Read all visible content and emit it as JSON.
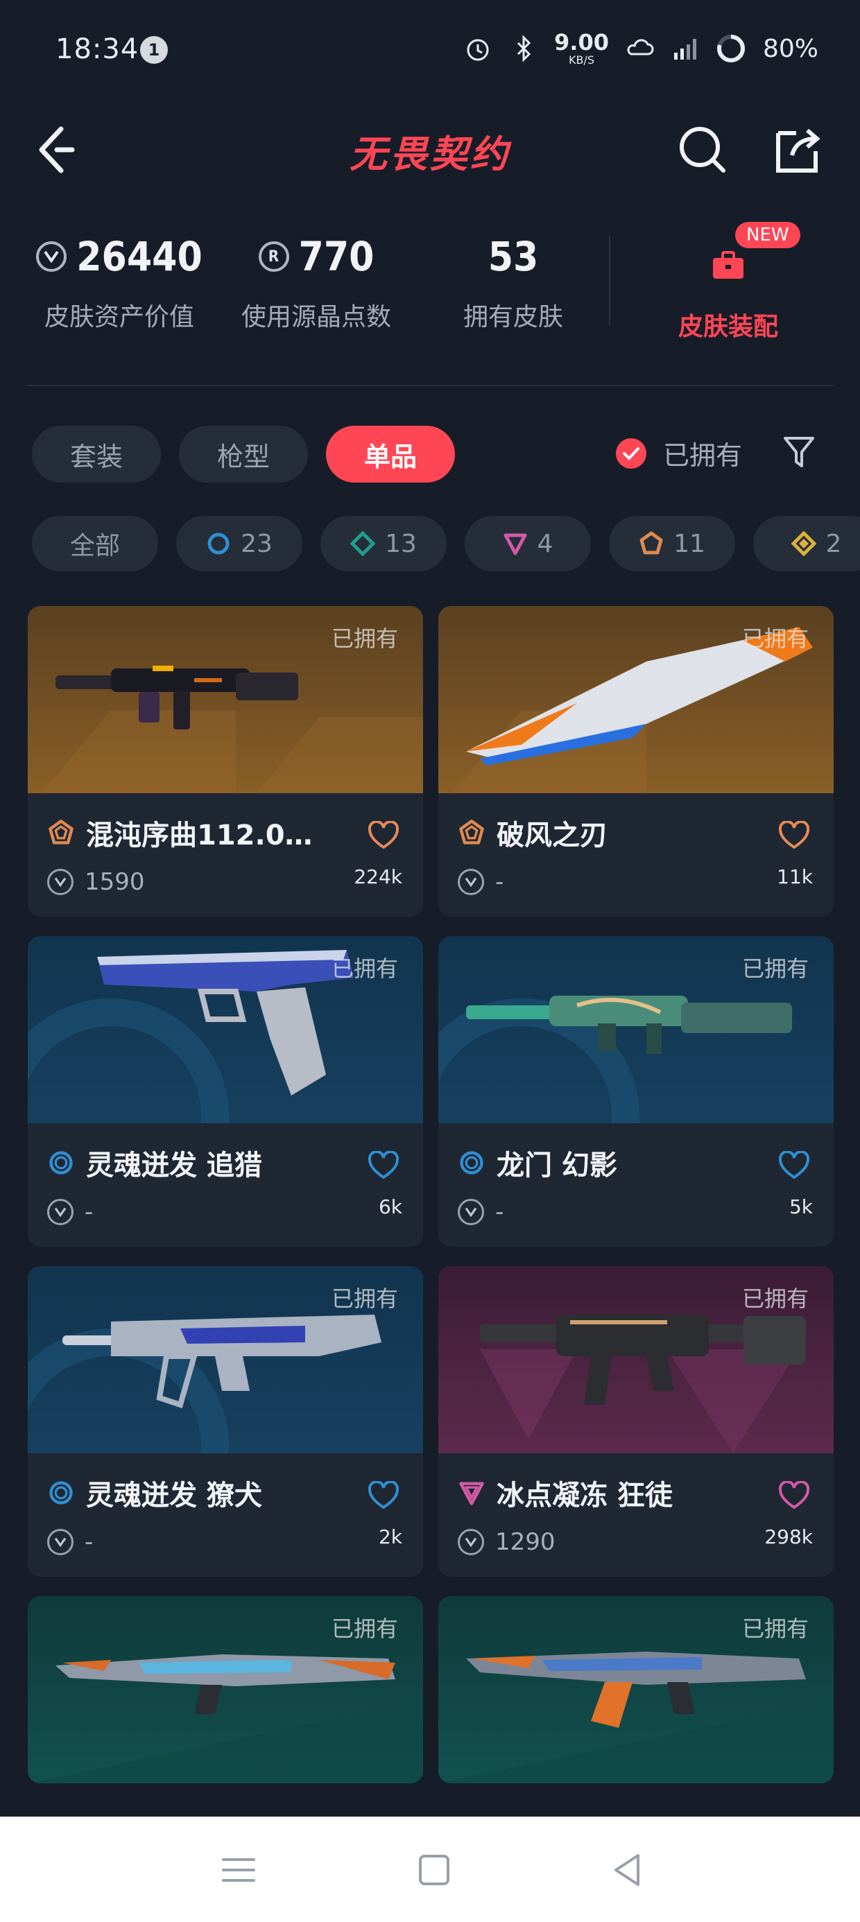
{
  "status_bar": {
    "time": "18:34",
    "notification_count": "1",
    "net_speed": "9.00",
    "net_unit": "KB/S",
    "battery": "80%"
  },
  "header": {
    "title": "无畏契约"
  },
  "stats": [
    {
      "value": "26440",
      "label": "皮肤资产价值",
      "icon": "vp-coin-icon"
    },
    {
      "value": "770",
      "label": "使用源晶点数",
      "icon": "radianite-icon"
    },
    {
      "value": "53",
      "label": "拥有皮肤",
      "icon": ""
    }
  ],
  "loadout": {
    "label": "皮肤装配",
    "badge": "NEW"
  },
  "tabs": [
    {
      "label": "套装",
      "active": false
    },
    {
      "label": "枪型",
      "active": false
    },
    {
      "label": "单品",
      "active": true
    }
  ],
  "owned_filter": {
    "label": "已拥有",
    "checked": true
  },
  "rarity_chips": [
    {
      "label": "全部",
      "tier": ""
    },
    {
      "count": "23",
      "tier": "select",
      "color": "#2f8fd3"
    },
    {
      "count": "13",
      "tier": "deluxe",
      "color": "#1f9e8c"
    },
    {
      "count": "4",
      "tier": "premium",
      "color": "#d45aa6"
    },
    {
      "count": "11",
      "tier": "ultra",
      "color": "#e08a50"
    },
    {
      "count": "2",
      "tier": "exclusive",
      "color": "#d9b23a"
    }
  ],
  "skins": [
    {
      "name": "混沌序曲112.0…",
      "price": "1590",
      "likes": "224k",
      "owned": "已拥有",
      "tier": "ultra",
      "bg": "orange",
      "heart": "#e88a57"
    },
    {
      "name": "破风之刃",
      "price": "-",
      "likes": "11k",
      "owned": "已拥有",
      "tier": "ultra",
      "bg": "orange",
      "heart": "#e88a57"
    },
    {
      "name": "灵魂迸发 追猎",
      "price": "-",
      "likes": "6k",
      "owned": "已拥有",
      "tier": "select",
      "bg": "blue",
      "heart": "#2f8fd3"
    },
    {
      "name": "龙门 幻影",
      "price": "-",
      "likes": "5k",
      "owned": "已拥有",
      "tier": "select",
      "bg": "blue",
      "heart": "#2f8fd3"
    },
    {
      "name": "灵魂迸发 獠犬",
      "price": "-",
      "likes": "2k",
      "owned": "已拥有",
      "tier": "select",
      "bg": "blue",
      "heart": "#2f8fd3"
    },
    {
      "name": "冰点凝冻 狂徒",
      "price": "1290",
      "likes": "298k",
      "owned": "已拥有",
      "tier": "premium",
      "bg": "pink",
      "heart": "#d45aa6"
    },
    {
      "name": "",
      "price": "",
      "likes": "",
      "owned": "已拥有",
      "tier": "",
      "bg": "teal",
      "heart": ""
    },
    {
      "name": "",
      "price": "",
      "likes": "",
      "owned": "已拥有",
      "tier": "",
      "bg": "teal",
      "heart": ""
    }
  ]
}
